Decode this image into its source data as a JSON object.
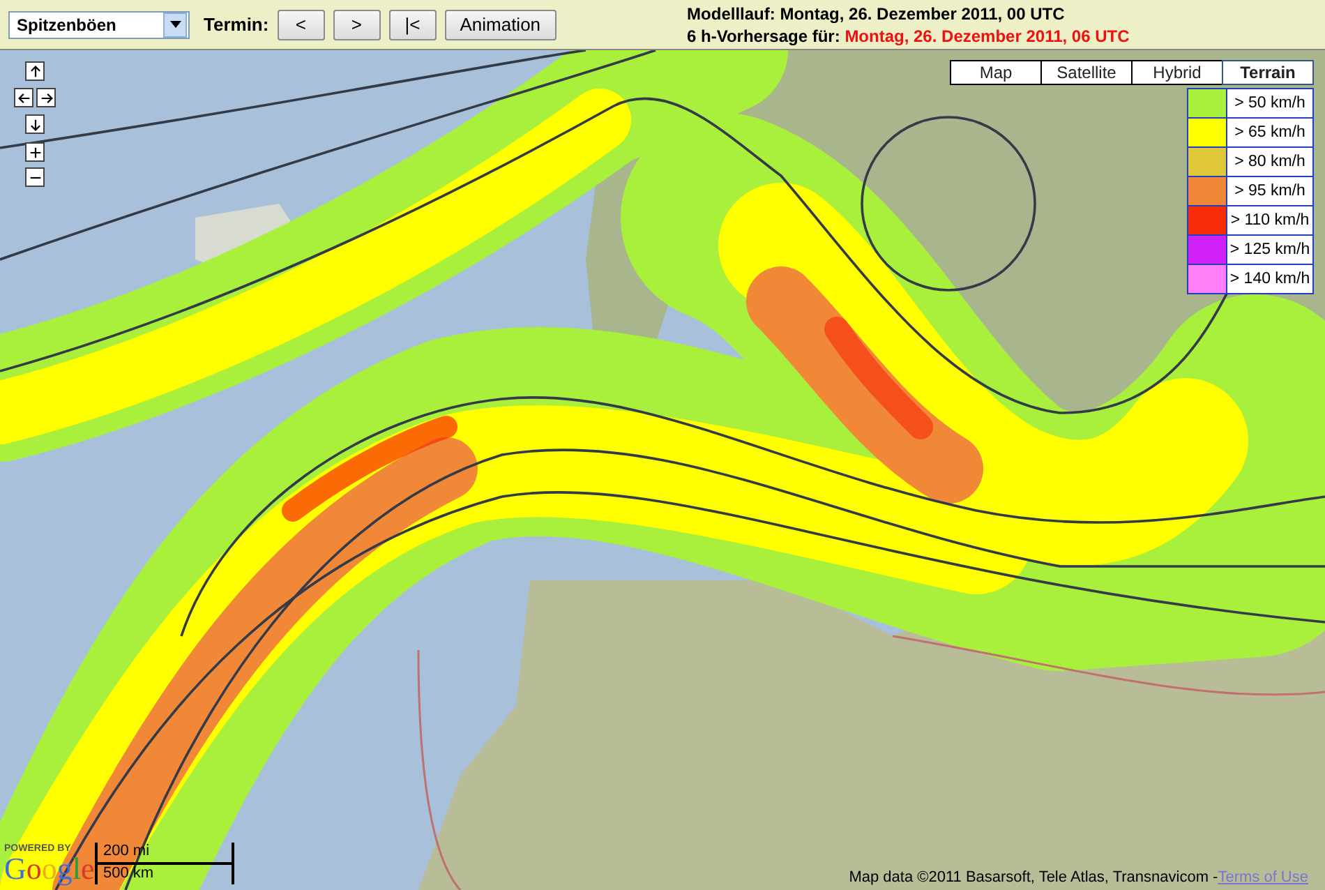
{
  "toolbar": {
    "product_select": {
      "value": "Spitzenböen"
    },
    "termin_label": "Termin:",
    "buttons": [
      "<",
      ">",
      "|<",
      "Animation"
    ]
  },
  "run_info": {
    "model_run": "Modelllauf: Montag, 26. Dezember 2011, 00 UTC",
    "forecast_label": "6 h-Vorhersage für:",
    "forecast_time": "Montag, 26. Dezember 2011, 06 UTC"
  },
  "map_types": [
    {
      "label": "Map",
      "selected": false
    },
    {
      "label": "Satellite",
      "selected": false
    },
    {
      "label": "Hybrid",
      "selected": false
    },
    {
      "label": "Terrain",
      "selected": true
    }
  ],
  "legend": [
    {
      "label": "> 50 km/h",
      "color": "#a8f03c"
    },
    {
      "label": "> 65 km/h",
      "color": "#ffff00"
    },
    {
      "label": "> 80 km/h",
      "color": "#e0c838"
    },
    {
      "label": "> 95 km/h",
      "color": "#f08838"
    },
    {
      "label": "> 110 km/h",
      "color": "#f82c08"
    },
    {
      "label": "> 125 km/h",
      "color": "#d020f8"
    },
    {
      "label": "> 140 km/h",
      "color": "#ff80f8"
    }
  ],
  "branding": {
    "powered_by": "POWERED BY",
    "logo": "Google"
  },
  "scale": {
    "imperial": "200 mi",
    "metric": "500 km"
  },
  "attribution": {
    "text": "Map data ©2011 Basarsoft, Tele Atlas, Transnavicom - ",
    "link": "Terms of Use"
  }
}
